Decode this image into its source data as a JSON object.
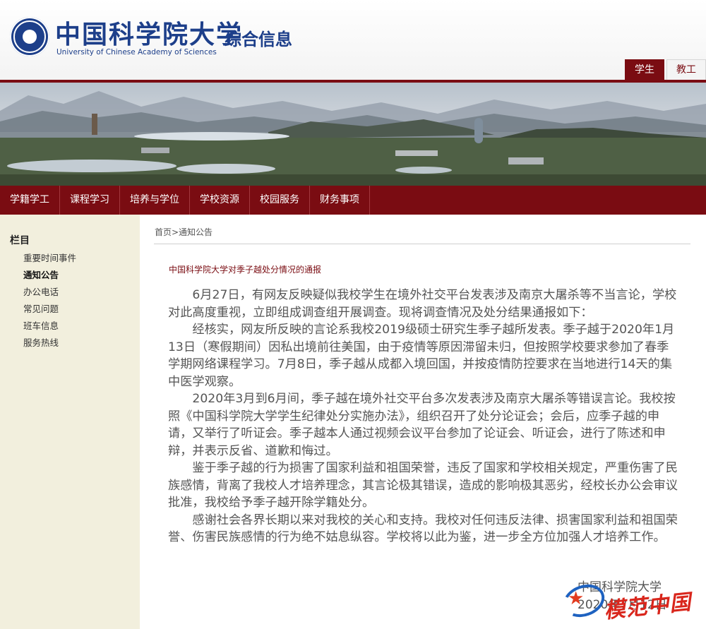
{
  "header": {
    "logo_cn": "中国科学院大学",
    "logo_en": "University of Chinese Academy of Sciences",
    "site_title": "综合信息",
    "role_tabs": [
      {
        "label": "学生",
        "active": true
      },
      {
        "label": "教工",
        "active": false
      }
    ]
  },
  "nav": {
    "items": [
      "学籍学工",
      "课程学习",
      "培养与学位",
      "学校资源",
      "校园服务",
      "财务事项"
    ]
  },
  "sidebar": {
    "title": "栏目",
    "items": [
      {
        "label": "重要时间事件",
        "active": false
      },
      {
        "label": "通知公告",
        "active": true
      },
      {
        "label": "办公电话",
        "active": false
      },
      {
        "label": "常见问题",
        "active": false
      },
      {
        "label": "班车信息",
        "active": false
      },
      {
        "label": "服务热线",
        "active": false
      }
    ]
  },
  "breadcrumb": {
    "text": "首页>通知公告"
  },
  "article": {
    "title": "中国科学院大学对季子越处分情况的通报",
    "paragraphs": [
      "6月27日，有网友反映疑似我校学生在境外社交平台发表涉及南京大屠杀等不当言论，学校对此高度重视，立即组成调查组开展调查。现将调查情况及处分结果通报如下：",
      "经核实，网友所反映的言论系我校2019级硕士研究生季子越所发表。季子越于2020年1月13日（寒假期间）因私出境前往美国，由于疫情等原因滞留未归，但按照学校要求参加了春季学期网络课程学习。7月8日，季子越从成都入境回国，并按疫情防控要求在当地进行14天的集中医学观察。",
      "2020年3月到6月间，季子越在境外社交平台多次发表涉及南京大屠杀等错误言论。我校按照《中国科学院大学学生纪律处分实施办法》，组织召开了处分论证会；会后，应季子越的申请，又举行了听证会。季子越本人通过视频会议平台参加了论证会、听证会，进行了陈述和申辩，并表示反省、道歉和悔过。",
      "鉴于季子越的行为损害了国家利益和祖国荣誉，违反了国家和学校相关规定，严重伤害了民族感情，背离了我校人才培养理念，其言论极其错误，造成的影响极其恶劣，经校长办公会审议批准，我校给予季子越开除学籍处分。",
      "感谢社会各界长期以来对我校的关心和支持。我校对任何违反法律、损害国家利益和祖国荣誉、伤害民族感情的行为绝不姑息纵容。学校将以此为鉴，进一步全方位加强人才培养工作。"
    ],
    "signer": "中国科学院大学",
    "date": "2020年7月12日"
  },
  "watermark": {
    "text": "模范中国"
  },
  "colors": {
    "brand_red": "#7a0c12",
    "brand_blue": "#1d3f8a",
    "sidebar_bg": "#f2efdd"
  },
  "icons": [
    "university-seal-icon",
    "watermark-star-icon"
  ]
}
